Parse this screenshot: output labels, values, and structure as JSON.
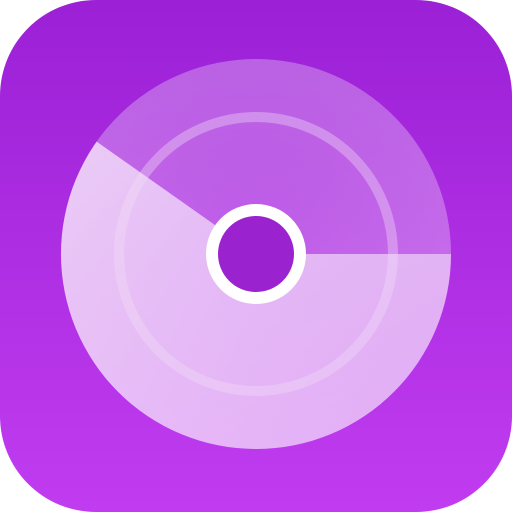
{
  "app_icon": {
    "icon": "disc-icon",
    "colors": {
      "background_top": "#9B20D6",
      "background_bottom": "#C13CF0",
      "disc_outer": "#E6B8F2",
      "disc_highlight": "#F2D9F8",
      "disc_ring": "#EFD2F6",
      "hub_ring": "#FFFFFF",
      "hub_center": "#9A22CF"
    }
  }
}
